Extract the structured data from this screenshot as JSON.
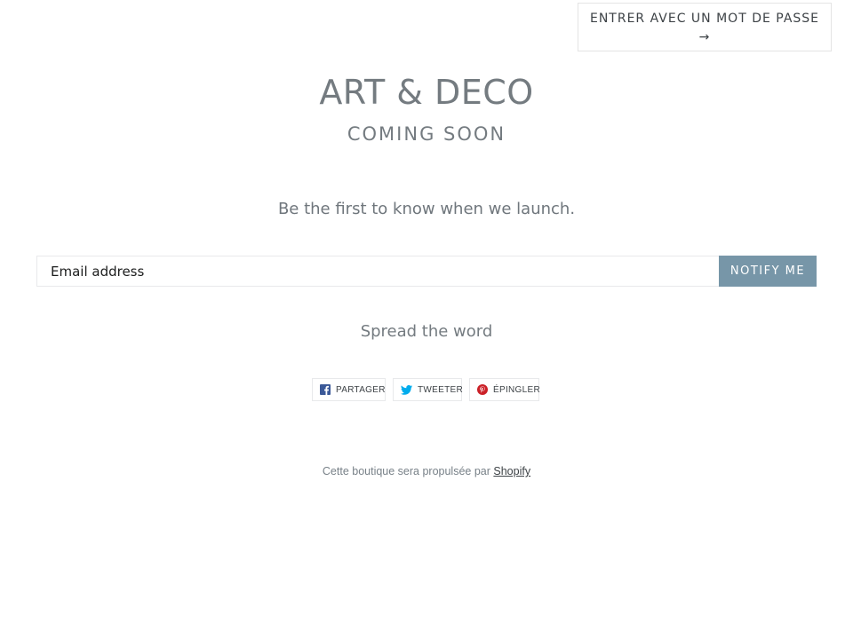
{
  "header": {
    "password_button_label": "ENTRER AVEC UN MOT DE PASSE",
    "password_button_arrow": "→"
  },
  "hero": {
    "shop_title": "ART & DECO",
    "subtitle": "COMING SOON",
    "tagline": "Be the first to know when we launch."
  },
  "signup": {
    "email_placeholder": "Email address",
    "email_value": "",
    "submit_label": "NOTIFY ME"
  },
  "social": {
    "heading": "Spread the word",
    "buttons": [
      {
        "label": "PARTAGER",
        "icon": "facebook-icon",
        "color": "#3b5998"
      },
      {
        "label": "TWEETER",
        "icon": "twitter-icon",
        "color": "#00aced"
      },
      {
        "label": "ÉPINGLER",
        "icon": "pinterest-icon",
        "color": "#cb2027"
      }
    ]
  },
  "footer": {
    "powered_text": "Cette boutique sera propulsée par",
    "powered_link": "Shopify"
  },
  "colors": {
    "accent": "#7796a8",
    "text": "#747b80",
    "border": "#e8e9eb"
  }
}
